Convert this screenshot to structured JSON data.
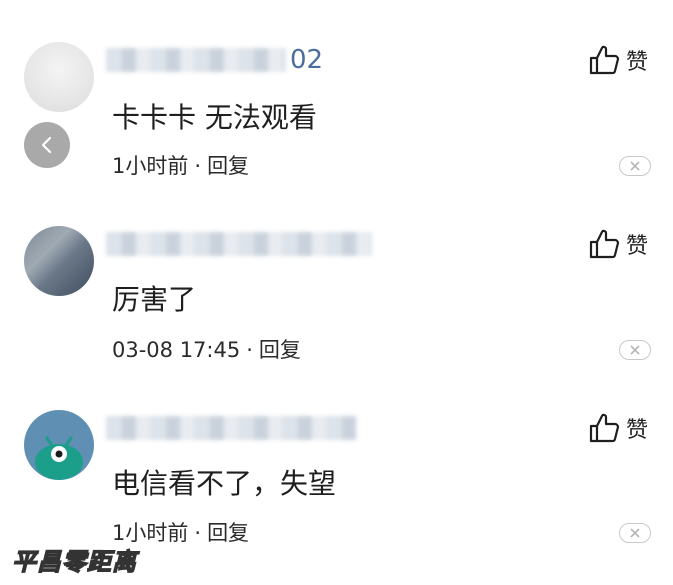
{
  "comments": [
    {
      "username_tail": "02",
      "content": "卡卡卡 无法观看",
      "time": "1小时前",
      "reply_label": "回复",
      "like_label": "赞"
    },
    {
      "username_tail": "",
      "content": "厉害了",
      "time": "03-08 17:45",
      "reply_label": "回复",
      "like_label": "赞"
    },
    {
      "username_tail": "",
      "content": "电信看不了，失望",
      "time": "1小时前",
      "reply_label": "回复",
      "like_label": "赞"
    }
  ],
  "meta_separator": "·",
  "watermark": "平昌零距离",
  "colors": {
    "username": "#4a6f9e",
    "avatar3": "#5f8fb3",
    "avatar3_monster": "#1b9e8a",
    "back_button": "#9b9b9b"
  }
}
